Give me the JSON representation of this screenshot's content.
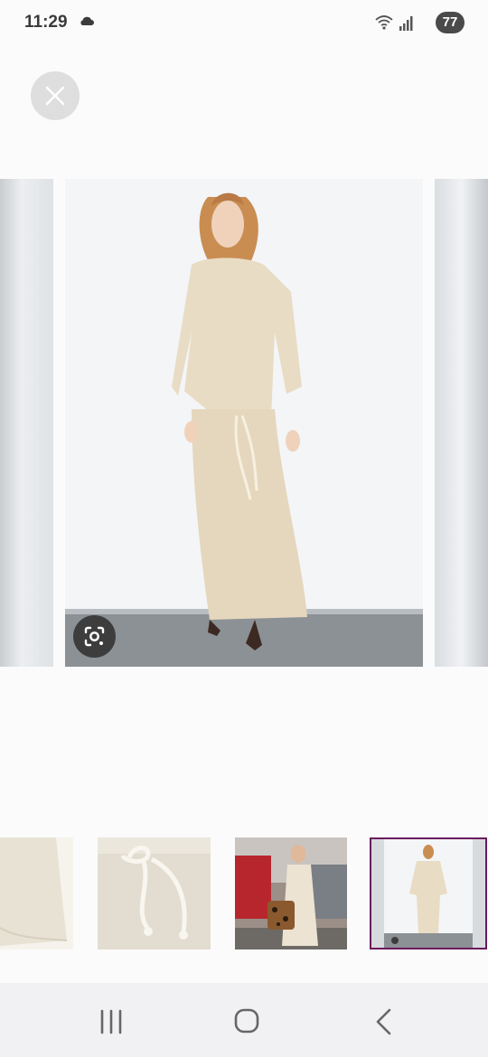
{
  "status_bar": {
    "time": "11:29",
    "battery": "77",
    "icons": [
      "cloud-icon",
      "wifi-icon",
      "signal-icon"
    ]
  },
  "viewer": {
    "close_icon": "close-icon",
    "lens_icon": "google-lens-icon",
    "colors": {
      "garment": "#e9dcc4",
      "floor": "#8c9195",
      "wall": "#f2f4f6",
      "selected_thumb_border": "#6a1b5e"
    }
  },
  "thumbnails": {
    "count": 4,
    "selected_index": 3
  },
  "nav_bar": {
    "icons": [
      "recents-icon",
      "home-icon",
      "back-icon"
    ]
  }
}
